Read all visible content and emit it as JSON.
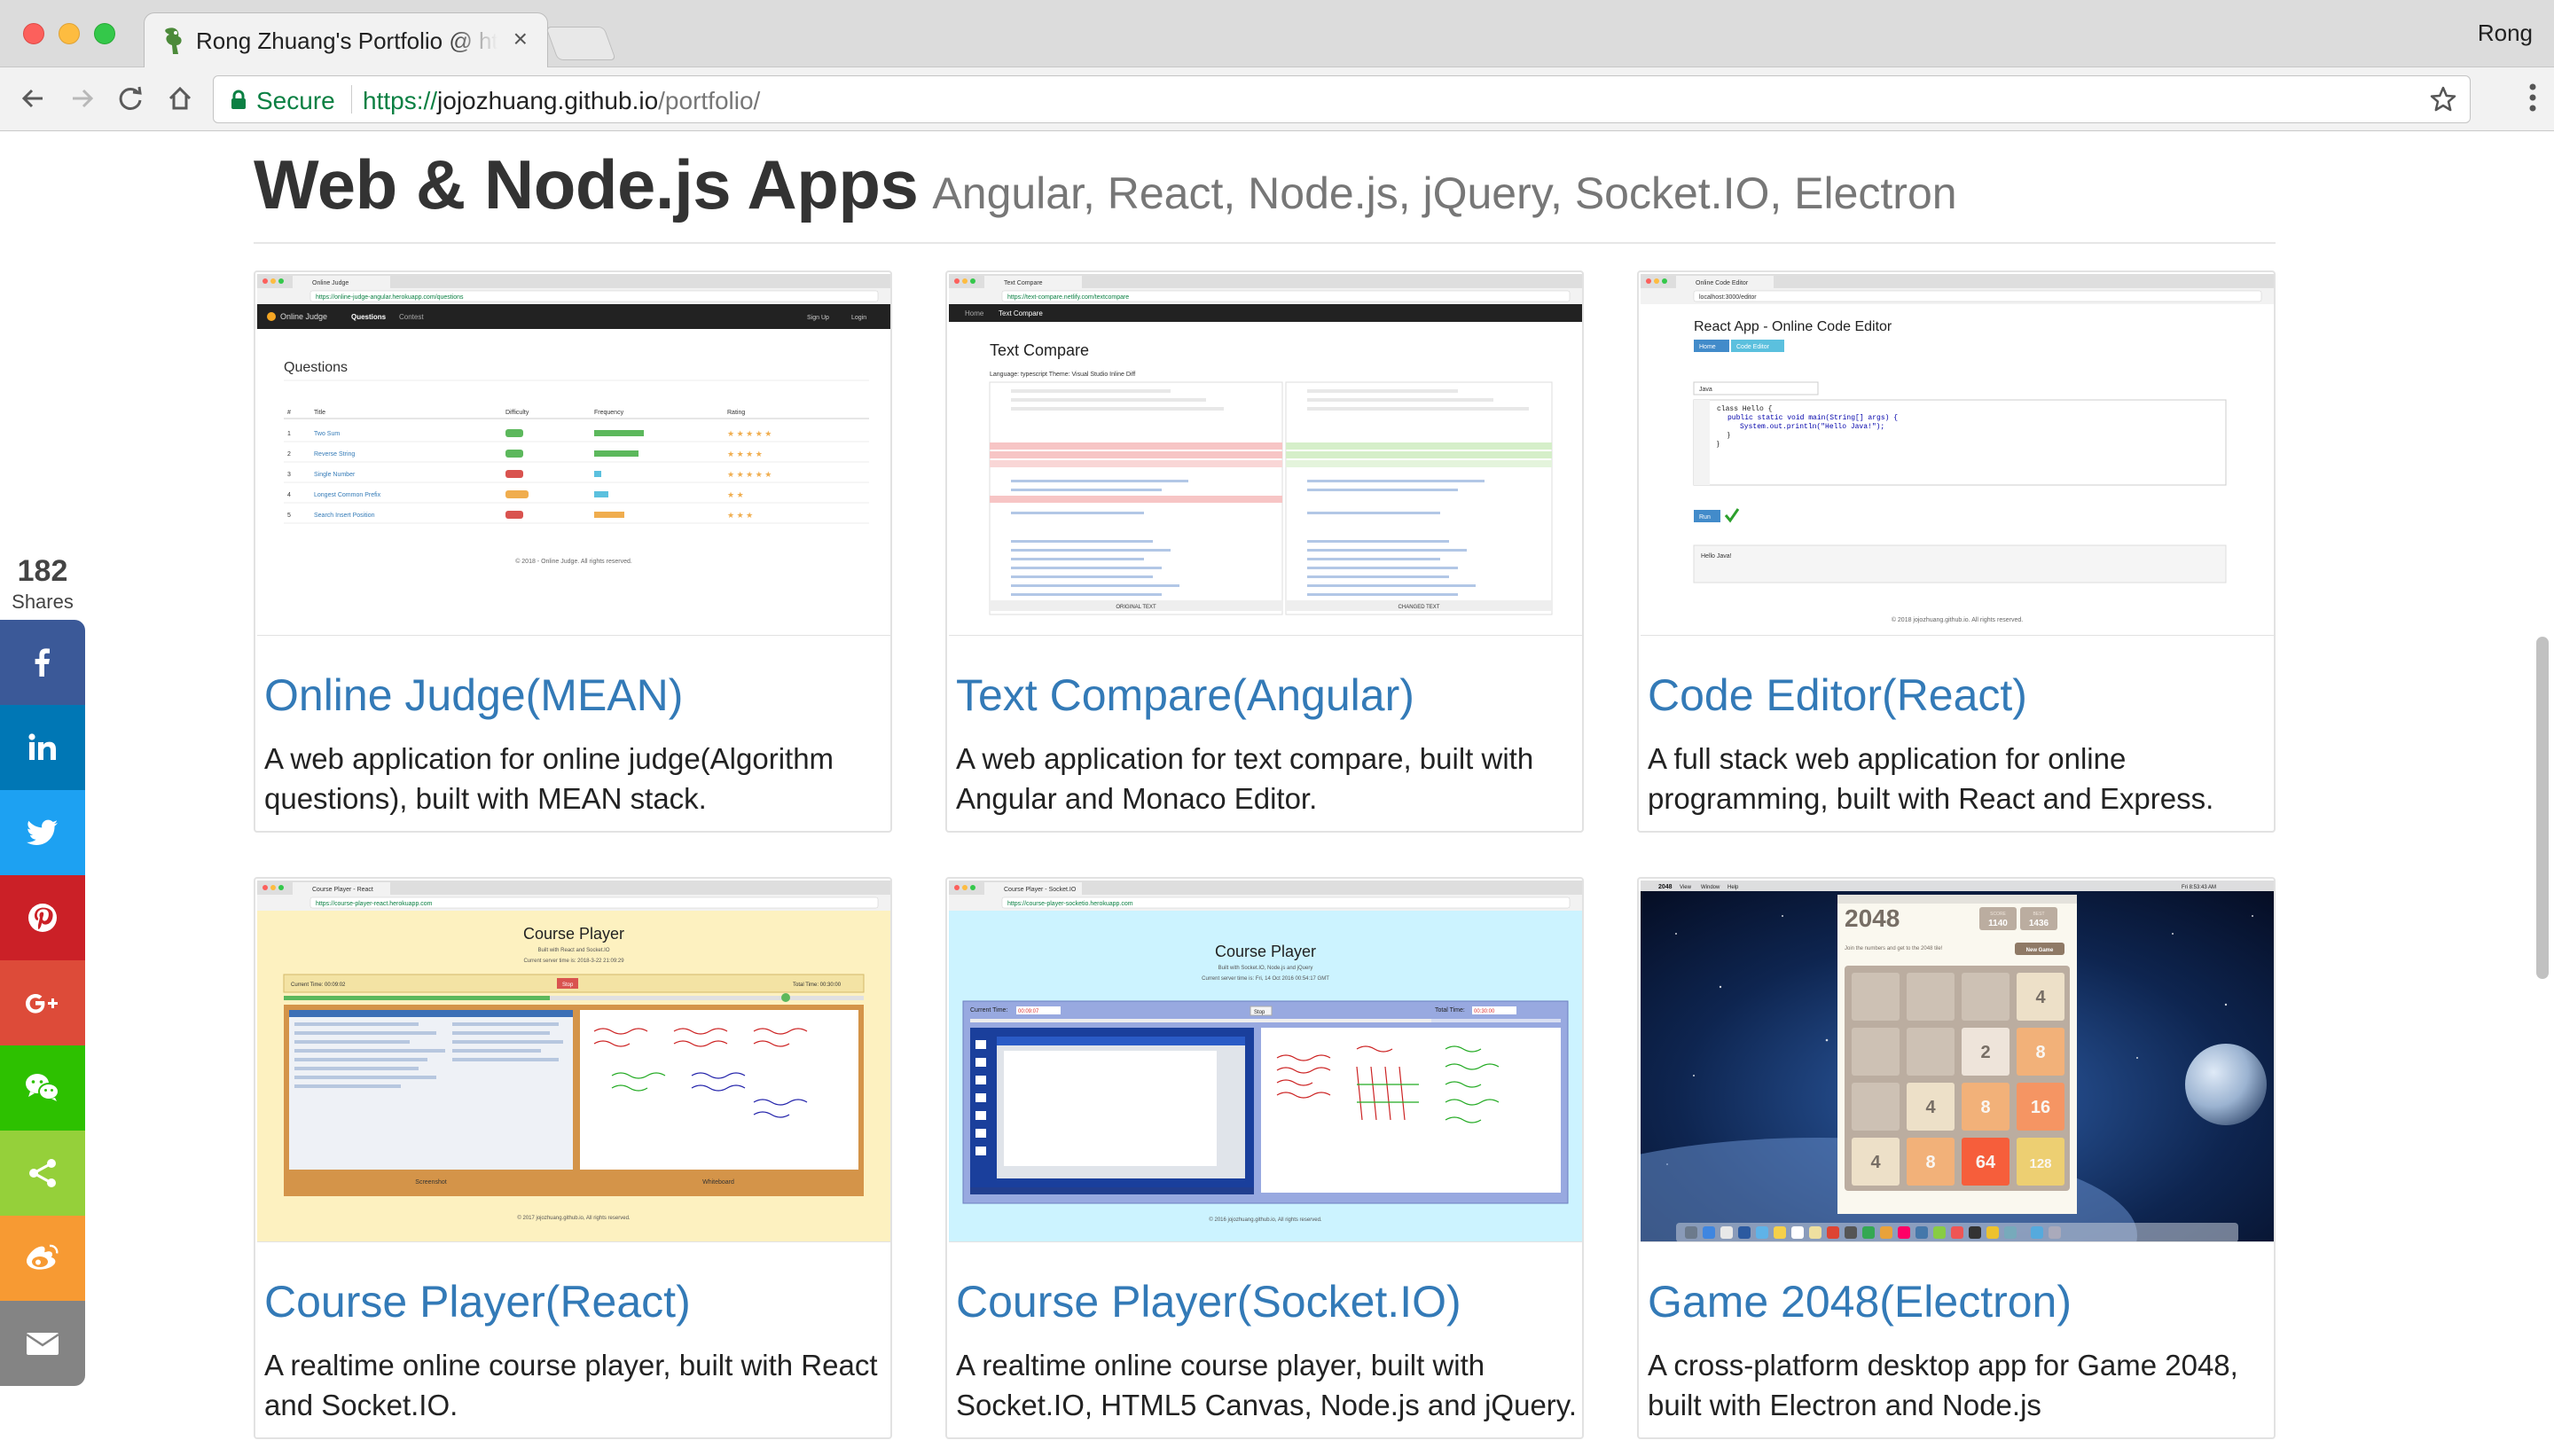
{
  "browser": {
    "tab_title": "Rong Zhuang's Portfolio @ https://jojozhuang.github.io/portfolio/",
    "tab_close": "×",
    "profile_name": "Rong",
    "secure_label": "Secure",
    "url_scheme": "https://",
    "url_host": "jojozhuang.github.io",
    "url_path": "/portfolio/"
  },
  "heading": {
    "title": "Web & Node.js Apps",
    "subtitle": "Angular, React, Node.js, jQuery, Socket.IO, Electron"
  },
  "share": {
    "count": "182",
    "label": "Shares",
    "buttons": [
      {
        "icon": "facebook-icon",
        "color": "#3b5998"
      },
      {
        "icon": "linkedin-icon",
        "color": "#0077b5"
      },
      {
        "icon": "twitter-icon",
        "color": "#1da1f2"
      },
      {
        "icon": "pinterest-icon",
        "color": "#cb2027"
      },
      {
        "icon": "google-plus-icon",
        "color": "#dd4b39"
      },
      {
        "icon": "wechat-icon",
        "color": "#2dc100"
      },
      {
        "icon": "share-icon",
        "color": "#95d03a"
      },
      {
        "icon": "weibo-icon",
        "color": "#f79a33"
      },
      {
        "icon": "email-icon",
        "color": "#848484"
      }
    ]
  },
  "cards": [
    {
      "title": "Online Judge(MEAN)",
      "desc": "A web application for online judge(Algorithm questions), built with MEAN stack.",
      "shot": {
        "tab": "Online Judge",
        "url": "https://online-judge-angular.herokuapp.com/questions",
        "brand": "Online Judge",
        "nav1": "Questions",
        "nav2": "Contest",
        "signup": "Sign Up",
        "login": "Login",
        "heading": "Questions",
        "cols": [
          "#",
          "Title",
          "Difficulty",
          "Frequency",
          "Rating"
        ],
        "rows": [
          [
            "1",
            "Two Sum",
            "Easy"
          ],
          [
            "2",
            "Reverse String",
            "Easy"
          ],
          [
            "3",
            "Single Number",
            "Hard"
          ],
          [
            "4",
            "Longest Common Prefix",
            "Medium"
          ],
          [
            "5",
            "Search Insert Position",
            "Hard"
          ]
        ],
        "footer": "© 2018 - Online Judge. All rights reserved."
      }
    },
    {
      "title": "Text Compare(Angular)",
      "desc": "A web application for text compare, built with Angular and Monaco Editor.",
      "shot": {
        "tab": "Text Compare",
        "url": "https://text-compare.netlify.com/textcompare",
        "nav1": "Home",
        "nav2": "Text Compare",
        "heading": "Text Compare",
        "options": "Language: typescript   Theme: Visual Studio   Inline Diff",
        "left_label": "ORIGINAL TEXT",
        "right_label": "CHANGED TEXT"
      }
    },
    {
      "title": "Code Editor(React)",
      "desc": "A full stack web application for online programming, built with React and Express.",
      "shot": {
        "tab": "Online Code Editor",
        "url": "localhost:3000/editor",
        "heading": "React App - Online Code Editor",
        "btn1": "Home",
        "btn2": "Code Editor",
        "lang": "Java",
        "code1": "class Hello {",
        "code2": "public static void main(String[] args) {",
        "code3": "System.out.println(\"Hello Java!\");",
        "run": "Run",
        "output": "Hello Java!",
        "footer": "© 2018 jojozhuang.github.io. All rights reserved."
      }
    },
    {
      "title": "Course Player(React)",
      "desc": "A realtime online course player, built with React and Socket.IO.",
      "shot": {
        "tab": "Course Player - React",
        "url": "https://course-player-react.herokuapp.com",
        "heading": "Course Player",
        "sub": "Built with React and Socket.IO",
        "time": "Current server time is: 2018-3-22 21:09:29",
        "current": "Current Time: 00:09:02",
        "stop": "Stop",
        "total": "Total Time: 00:30:00",
        "left": "Screenshot",
        "right": "Whiteboard",
        "footer": "© 2017 jojozhuang.github.io, All rights reserved."
      }
    },
    {
      "title": "Course Player(Socket.IO)",
      "desc": "A realtime online course player, built with Socket.IO, HTML5 Canvas, Node.js and jQuery.",
      "shot": {
        "tab": "Course Player - Socket.IO",
        "url": "https://course-player-socketio.herokuapp.com",
        "heading": "Course Player",
        "sub": "Built with Socket.IO, Node.js and jQuery",
        "time": "Current server time is: Fri, 14 Oct 2016 00:54:17 GMT",
        "current": "Current Time:",
        "current_val": "00:09:07",
        "stop": "Stop",
        "total": "Total Time:",
        "total_val": "00:30:00",
        "footer": "© 2016 jojozhuang.github.io, All rights reserved."
      }
    },
    {
      "title": "Game 2048(Electron)",
      "desc": "A cross-platform desktop app for Game 2048, built with Electron and Node.js",
      "shot": {
        "app": "2048",
        "menu": [
          "View",
          "Window",
          "Help"
        ],
        "clock": "Fri 8:53:43 AM",
        "logo": "2048",
        "score_label": "SCORE",
        "score": "1140",
        "best_label": "BEST",
        "best": "1436",
        "intro": "Join the numbers and get to the 2048 tile!",
        "new_game": "New Game",
        "tiles": [
          "",
          "",
          "",
          "4",
          "",
          "",
          "2",
          "8",
          "",
          "4",
          "8",
          "16",
          "4",
          "8",
          "64",
          "128"
        ]
      }
    }
  ]
}
